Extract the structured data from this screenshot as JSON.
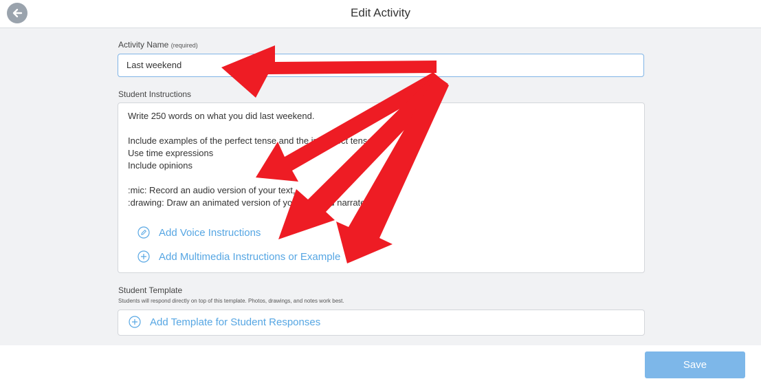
{
  "header": {
    "title": "Edit Activity",
    "back_icon": "arrow-left-circle-icon"
  },
  "activity_name": {
    "label": "Activity Name",
    "required_note": "(required)",
    "value": "Last weekend"
  },
  "student_instructions": {
    "label": "Student Instructions",
    "lines": [
      "Write 250 words on what you did last weekend.",
      "",
      "Include examples of the perfect tense and the imperfect tense",
      "Use time expressions",
      "Include opinions",
      "",
      ":mic: Record an audio version of your text,",
      ":drawing: Draw an animated version of your text and narrate it"
    ],
    "add_voice_label": "Add Voice Instructions",
    "add_voice_icon": "pencil-circle-icon",
    "add_multimedia_label": "Add Multimedia Instructions or Example",
    "add_multimedia_icon": "plus-circle-icon"
  },
  "student_template": {
    "label": "Student Template",
    "description": "Students will respond directly on top of this template. Photos, drawings, and notes work best.",
    "add_template_label": "Add Template for Student Responses",
    "add_template_icon": "plus-circle-icon"
  },
  "footer": {
    "save_label": "Save"
  },
  "colors": {
    "link": "#56a6e3",
    "save_button": "#7db7e9",
    "annotation_arrow": "#ee1c24",
    "content_background": "#f1f2f4"
  }
}
